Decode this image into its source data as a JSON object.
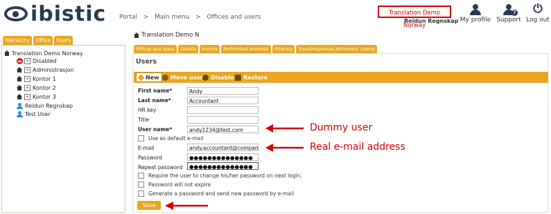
{
  "header": {
    "logo_text": "ibistic",
    "breadcrumb": [
      "Portal",
      ">",
      "Main menu",
      ">",
      "Offices and users"
    ],
    "company_name": "Translation Demo Norway",
    "user_name": "Reidun Regnskap",
    "buttons": [
      {
        "label": "My profile",
        "icon": "person-icon"
      },
      {
        "label": "Support",
        "icon": "support-icon"
      },
      {
        "label": "Log out",
        "icon": "power-icon"
      }
    ]
  },
  "left": {
    "tabs": [
      "Hierarchy",
      "Office",
      "Users"
    ],
    "tree": {
      "root": "Translation Demo Norway",
      "items": [
        {
          "label": "Disabled",
          "icon": "disabled-icon"
        },
        {
          "label": "Administrasjon",
          "icon": "office-icon"
        },
        {
          "label": "Kontor 1",
          "icon": "office-icon"
        },
        {
          "label": "Kontor 2",
          "icon": "office-icon"
        },
        {
          "label": "Kontor 3",
          "icon": "office-icon"
        },
        {
          "label": "Reidun Regnskap",
          "icon": "user-icon"
        },
        {
          "label": "Test User",
          "icon": "user-icon"
        }
      ]
    }
  },
  "main": {
    "title": "Translation Demo N",
    "tabs": [
      "Offices and users",
      "Details",
      "Invoice",
      "Authorised amounts",
      "Filtering",
      "Travel/expenses document coding"
    ],
    "section_title": "Users",
    "toolbar": {
      "new": "New",
      "move_user": "Move user",
      "disable": "Disable",
      "restore": "Restore"
    },
    "form": {
      "first_name_label": "First name*",
      "first_name": "Andy",
      "last_name_label": "Last name*",
      "last_name": "Accountant",
      "hr_key_label": "HR key",
      "hr_key": "",
      "title_label": "Title",
      "title": "",
      "user_name_label": "User name*",
      "user_name": "andy1234@test.com",
      "default_email_label": "Use as default e-mail",
      "email_label": "E-mail",
      "email": "andy.accountant@company.com",
      "password_label": "Password",
      "password": "●●●●●●●●●●●●●●",
      "repeat_password_label": "Repeat password",
      "repeat_password": "●●●●●●●●●●●●●●",
      "require_change_label": "Require the user to change his/her password on next login.",
      "never_expire_label": "Password will not expire",
      "generate_label": "Generate a password and send new password by e-mail",
      "save_label": "Save"
    },
    "annotations": {
      "dummy_user": "Dummy user",
      "real_email": "Real e-mail address"
    }
  },
  "colors": {
    "accent": "#e8a623",
    "annotation": "#d40000",
    "brand": "#2a3a4e"
  }
}
